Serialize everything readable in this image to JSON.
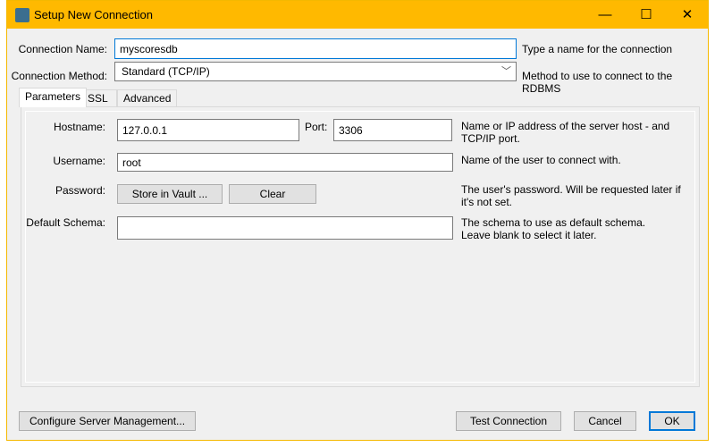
{
  "window": {
    "title": "Setup New Connection",
    "minimize": "—",
    "maximize": "☐",
    "close": "✕"
  },
  "connection_name": {
    "label": "Connection Name:",
    "value": "myscoresdb",
    "hint": "Type a name for the connection"
  },
  "connection_method": {
    "label": "Connection Method:",
    "value": "Standard (TCP/IP)",
    "hint": "Method to use to connect to the RDBMS"
  },
  "tabs": [
    {
      "label": "Parameters"
    },
    {
      "label": "SSL"
    },
    {
      "label": "Advanced"
    }
  ],
  "params": {
    "hostname": {
      "label": "Hostname:",
      "value": "127.0.0.1"
    },
    "port": {
      "label": "Port:",
      "value": "3306"
    },
    "host_hint": "Name or IP address of the server host - and TCP/IP port.",
    "username": {
      "label": "Username:",
      "value": "root",
      "hint": "Name of the user to connect with."
    },
    "password": {
      "label": "Password:",
      "store": "Store in Vault ...",
      "clear": "Clear",
      "hint": "The user's password. Will be requested later if it's not set."
    },
    "schema": {
      "label": "Default Schema:",
      "value": "",
      "hint": "The schema to use as default schema. Leave blank to select it later."
    }
  },
  "footer": {
    "configure": "Configure Server Management...",
    "test": "Test Connection",
    "cancel": "Cancel",
    "ok": "OK"
  },
  "colors": {
    "titlebar": "#ffb900",
    "focus": "#0078d7"
  }
}
